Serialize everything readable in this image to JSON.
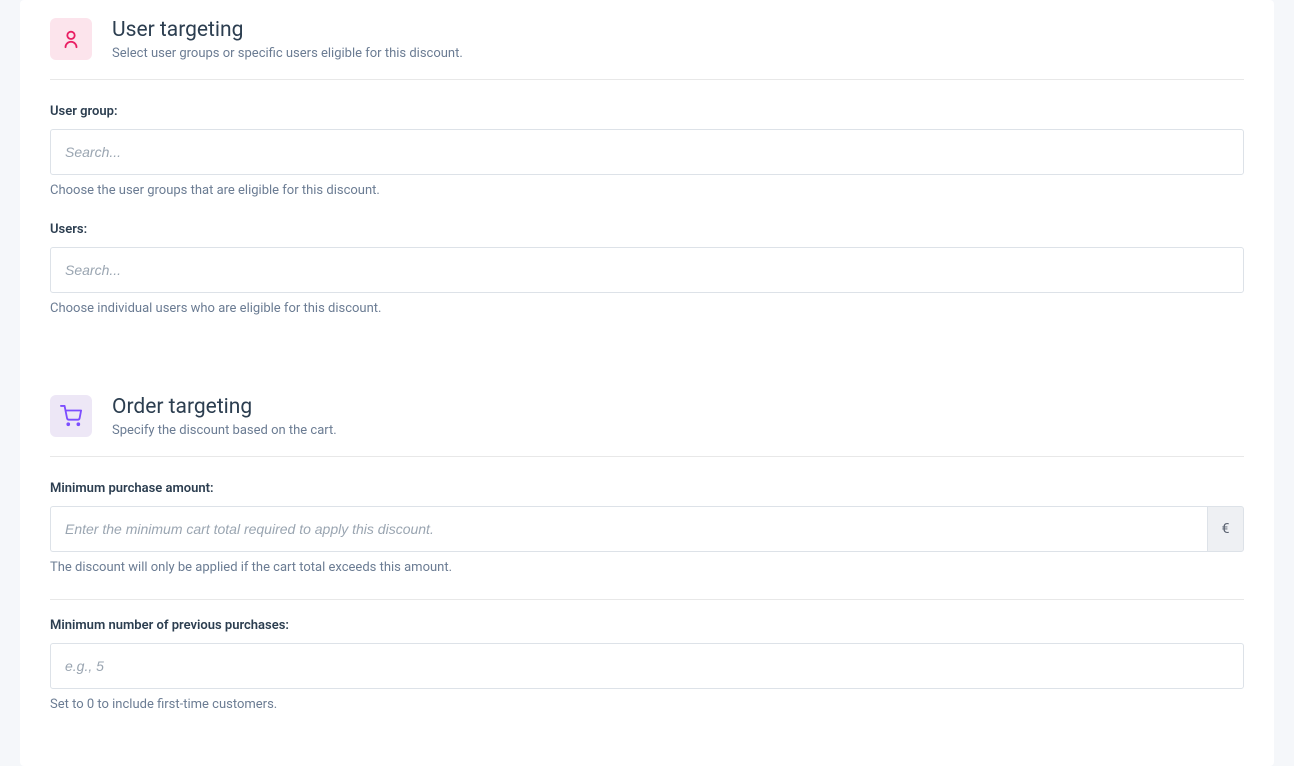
{
  "userTargeting": {
    "title": "User targeting",
    "subtitle": "Select user groups or specific users eligible for this discount.",
    "userGroup": {
      "label": "User group:",
      "placeholder": "Search...",
      "help": "Choose the user groups that are eligible for this discount."
    },
    "users": {
      "label": "Users:",
      "placeholder": "Search...",
      "help": "Choose individual users who are eligible for this discount."
    }
  },
  "orderTargeting": {
    "title": "Order targeting",
    "subtitle": "Specify the discount based on the cart.",
    "minPurchase": {
      "label": "Minimum purchase amount:",
      "placeholder": "Enter the minimum cart total required to apply this discount.",
      "currency": "€",
      "help": "The discount will only be applied if the cart total exceeds this amount."
    },
    "minPrevious": {
      "label": "Minimum number of previous purchases:",
      "placeholder": "e.g., 5",
      "help": "Set to 0 to include first-time customers."
    }
  }
}
